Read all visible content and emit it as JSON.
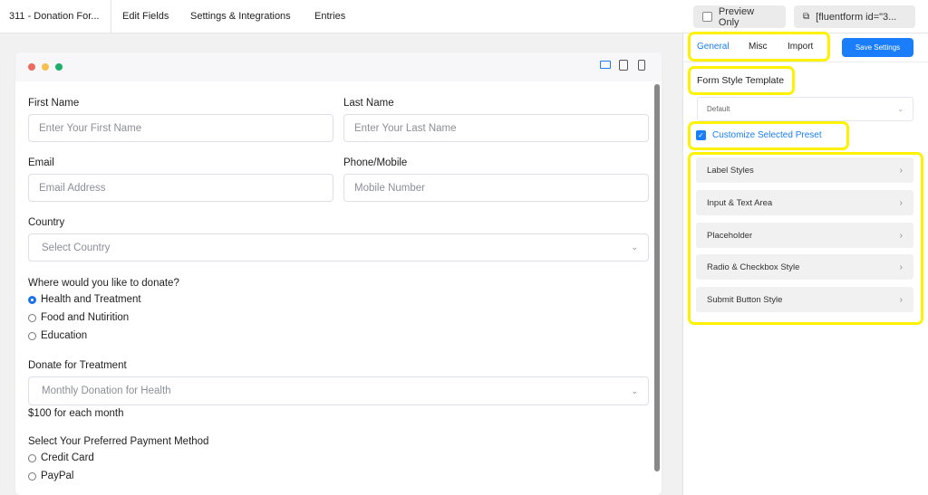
{
  "topbar": {
    "form_title": "311 - Donation For...",
    "nav": [
      "Edit Fields",
      "Settings & Integrations",
      "Entries"
    ],
    "preview_only": "Preview Only",
    "shortcode": "[fluentform id=\"3..."
  },
  "preview": {
    "window_dots": [
      "#ed6a5e",
      "#f5bf4f",
      "#61c554"
    ],
    "devices": [
      "desktop-icon",
      "tablet-icon",
      "mobile-icon"
    ]
  },
  "form": {
    "first_name": {
      "label": "First Name",
      "placeholder": "Enter Your First Name"
    },
    "last_name": {
      "label": "Last Name",
      "placeholder": "Enter Your Last Name"
    },
    "email": {
      "label": "Email",
      "placeholder": "Email Address"
    },
    "phone": {
      "label": "Phone/Mobile",
      "placeholder": "Mobile Number"
    },
    "country": {
      "label": "Country",
      "value": "Select Country"
    },
    "donate_where": {
      "label": "Where would you like to donate?",
      "options": [
        "Health and Treatment",
        "Food and Nutirition",
        "Education"
      ],
      "selected": 0
    },
    "donate_treatment": {
      "label": "Donate for Treatment",
      "value": "Monthly Donation for Health",
      "help": "$100 for each month"
    },
    "payment": {
      "label": "Select Your Preferred Payment Method",
      "options": [
        "Credit Card",
        "PayPal"
      ]
    }
  },
  "sidebar": {
    "tabs": [
      "General",
      "Misc",
      "Import"
    ],
    "active_tab": "General",
    "save": "Save Settings",
    "template_label": "Form Style Template",
    "template_value": "Default",
    "customize": "Customize Selected Preset",
    "customize_checked": true,
    "sections": [
      "Label Styles",
      "Input & Text Area",
      "Placeholder",
      "Radio & Checkbox Style",
      "Submit Button Style"
    ]
  },
  "colors": {
    "accent": "#1a7efb",
    "highlight": "#fff200"
  }
}
